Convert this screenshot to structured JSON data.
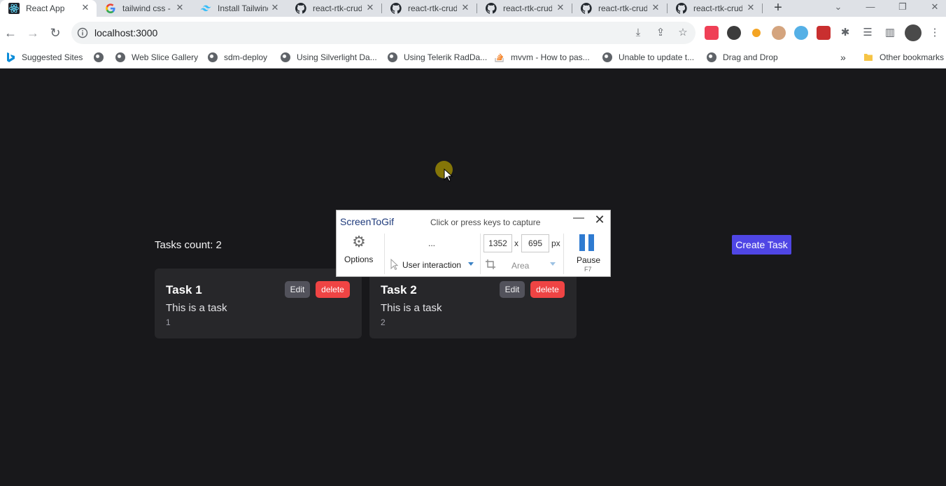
{
  "browser": {
    "tabs": [
      {
        "title": "React App",
        "icon": "react-icon",
        "active": true
      },
      {
        "title": "tailwind css - ",
        "icon": "google-icon",
        "active": false
      },
      {
        "title": "Install Tailwind",
        "icon": "tailwind-icon",
        "active": false
      },
      {
        "title": "react-rtk-crud",
        "icon": "github-icon",
        "active": false
      },
      {
        "title": "react-rtk-crud",
        "icon": "github-icon",
        "active": false
      },
      {
        "title": "react-rtk-crud",
        "icon": "github-icon",
        "active": false
      },
      {
        "title": "react-rtk-crud",
        "icon": "github-icon",
        "active": false
      },
      {
        "title": "react-rtk-crud",
        "icon": "github-icon",
        "active": false
      }
    ],
    "url": "localhost:3000",
    "bookmarks": [
      {
        "label": "Suggested Sites",
        "icon": "bing-icon"
      },
      {
        "label": "",
        "icon": "globe-icon"
      },
      {
        "label": "Web Slice Gallery",
        "icon": "globe-icon"
      },
      {
        "label": "sdm-deploy",
        "icon": "globe-icon"
      },
      {
        "label": "Using Silverlight Da...",
        "icon": "globe-icon"
      },
      {
        "label": "Using Telerik RadDa...",
        "icon": "globe-icon"
      },
      {
        "label": "mvvm - How to pas...",
        "icon": "stackoverflow-icon"
      },
      {
        "label": "Unable to update t...",
        "icon": "globe-icon"
      },
      {
        "label": "Drag and Drop",
        "icon": "globe-icon"
      }
    ],
    "other_bookmarks": "Other bookmarks",
    "overflow": "»"
  },
  "app": {
    "tasks_count": "Tasks count: 2",
    "create_button": "Create Task",
    "tasks": [
      {
        "title": "Task 1",
        "description": "This is a task",
        "id": "1",
        "edit_label": "Edit",
        "delete_label": "delete"
      },
      {
        "title": "Task 2",
        "description": "This is a task",
        "id": "2",
        "edit_label": "Edit",
        "delete_label": "delete"
      }
    ]
  },
  "recorder": {
    "title": "ScreenToGif",
    "hint": "Click or press keys to capture",
    "options_label": "Options",
    "dots": "...",
    "mode": "User interaction",
    "width": "1352",
    "height": "695",
    "x_sep": "x",
    "unit": "px",
    "area_label": "Area",
    "pause_label": "Pause",
    "pause_key": "F7"
  },
  "colors": {
    "page_bg": "#18181b",
    "card_bg": "#27272a",
    "accent": "#4f46e5",
    "danger": "#ef4444",
    "recorder_accent": "#2f7bd1"
  }
}
